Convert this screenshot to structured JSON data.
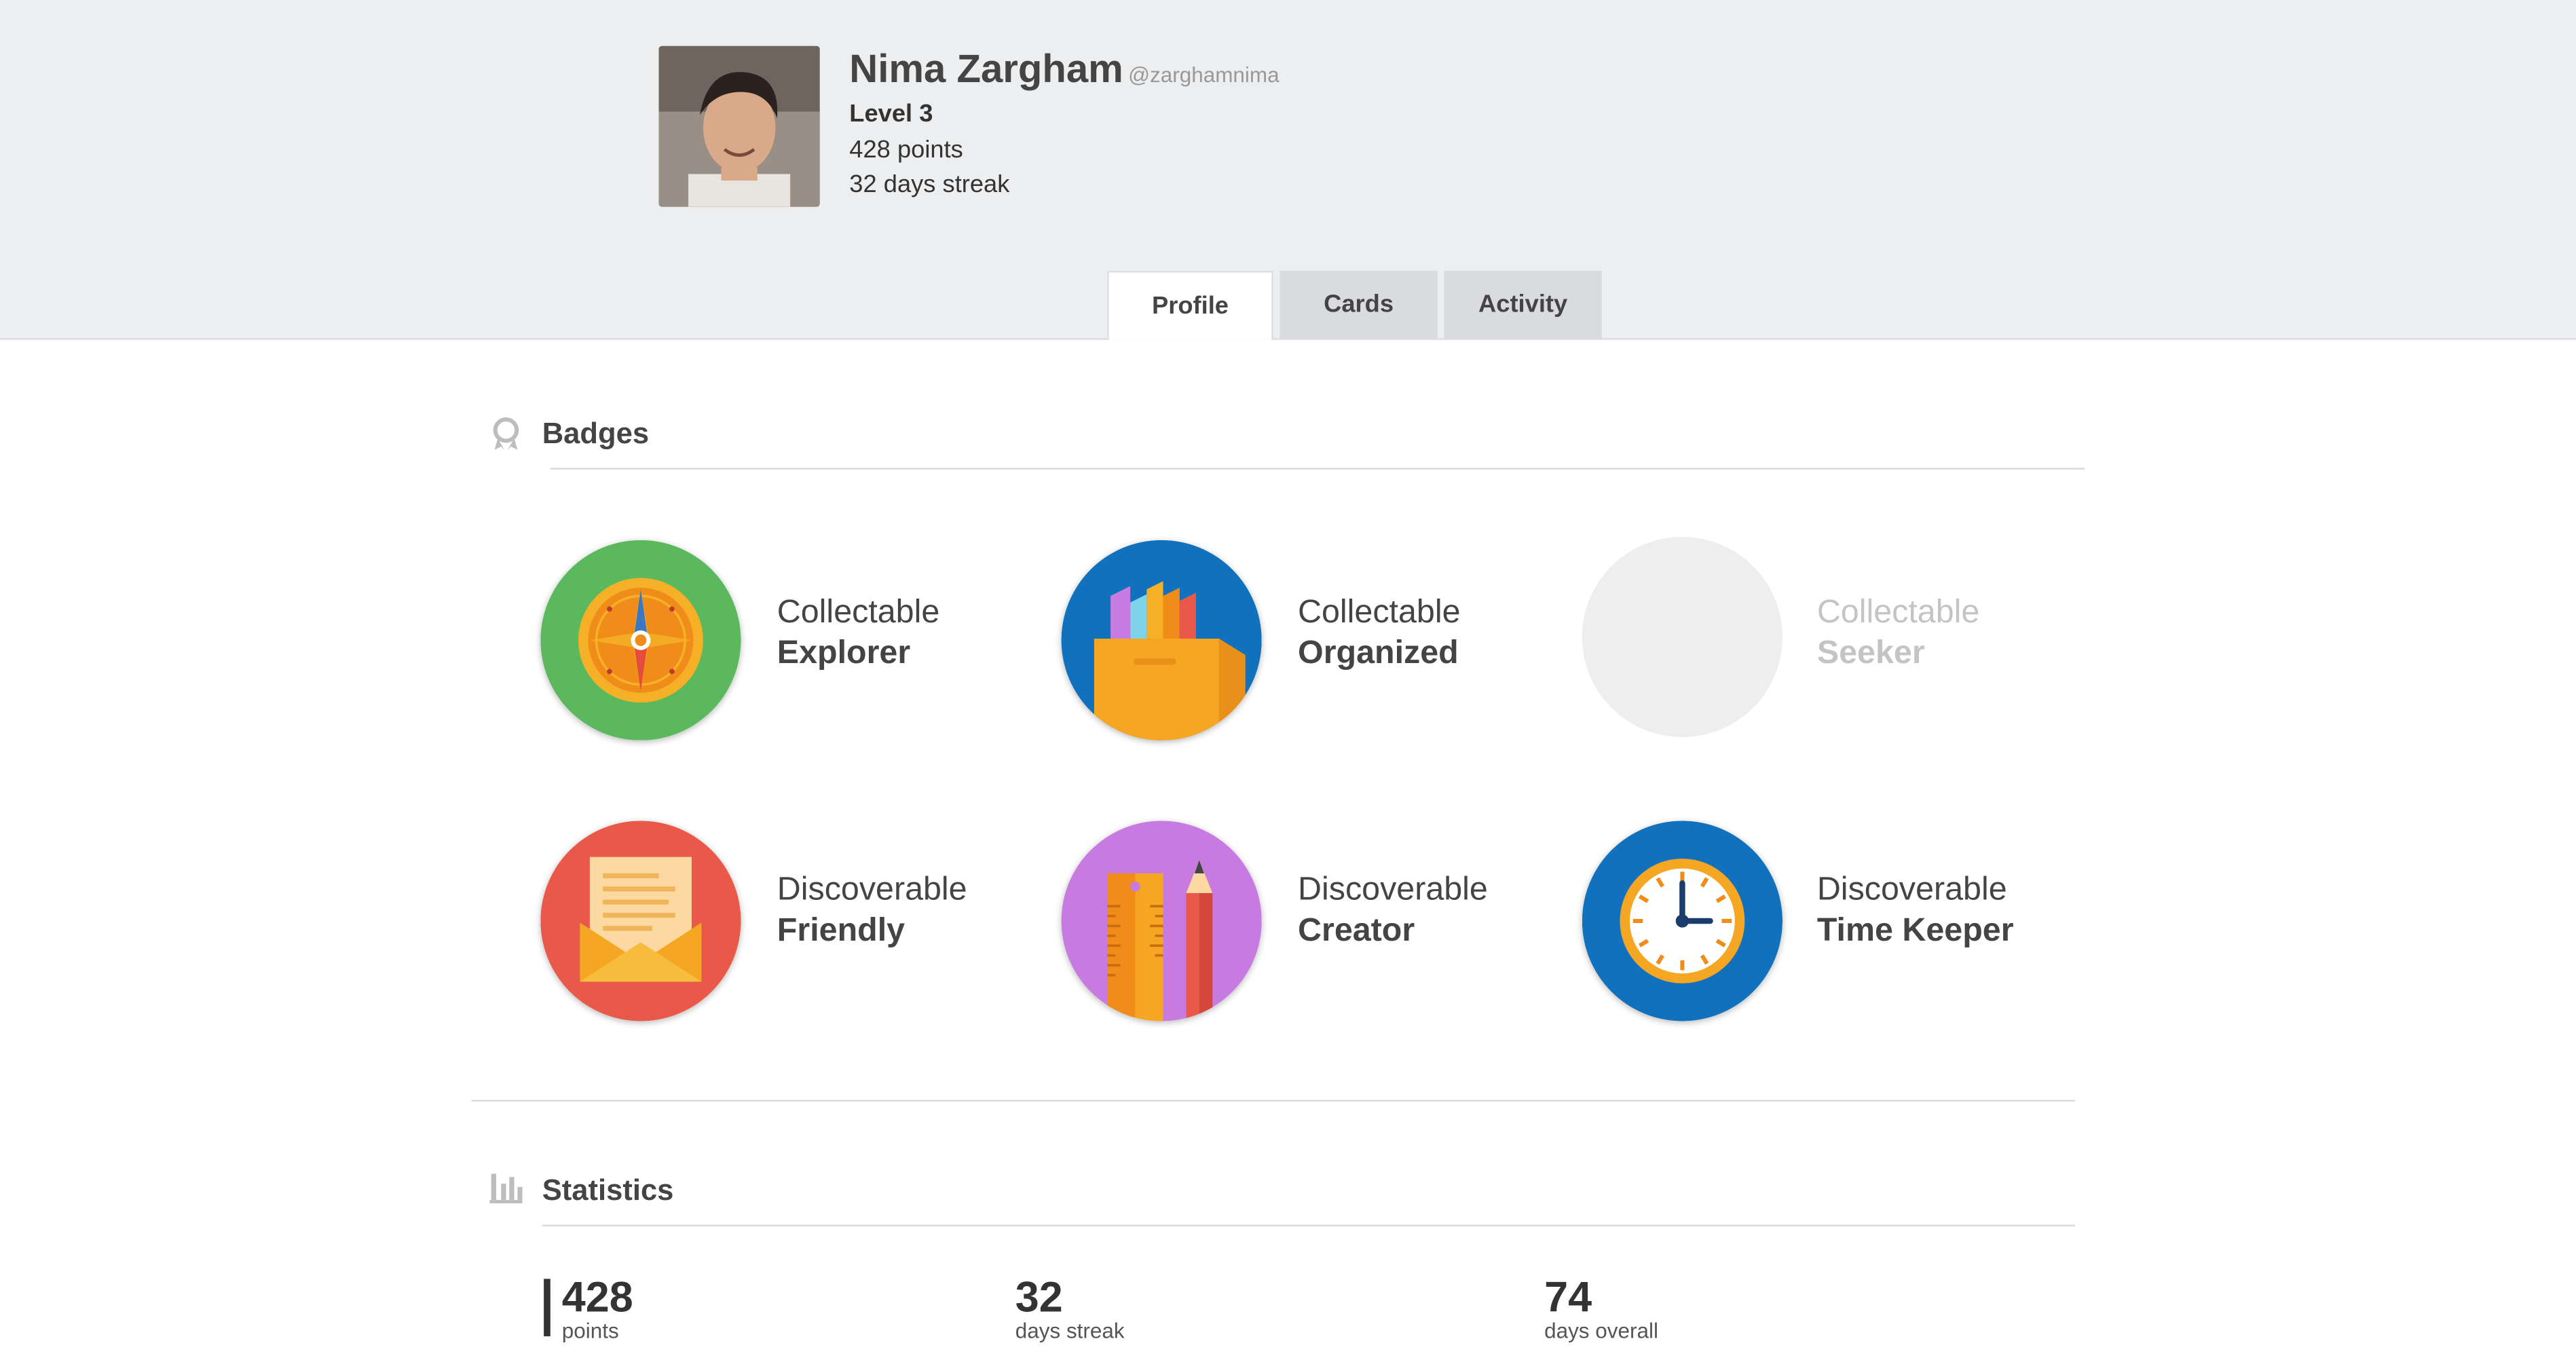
{
  "profile": {
    "name": "Nima Zargham",
    "handle": "@zarghamnima",
    "level": "Level 3",
    "points": "428 points",
    "streak": "32 days streak"
  },
  "tabs": [
    {
      "label": "Profile",
      "active": true
    },
    {
      "label": "Cards",
      "active": false
    },
    {
      "label": "Activity",
      "active": false
    }
  ],
  "badges_section": {
    "title": "Badges",
    "icon": "badge-ribbon-icon",
    "items": [
      {
        "kind": "Collectable",
        "name": "Explorer",
        "icon": "compass-icon",
        "color": "#5cb85c",
        "earned": true
      },
      {
        "kind": "Collectable",
        "name": "Organized",
        "icon": "folder-files-icon",
        "color": "#1271bd",
        "earned": true
      },
      {
        "kind": "Collectable",
        "name": "Seeker",
        "icon": "",
        "color": "#eeeeee",
        "earned": false
      },
      {
        "kind": "Discoverable",
        "name": "Friendly",
        "icon": "envelope-letter-icon",
        "color": "#e9594a",
        "earned": true
      },
      {
        "kind": "Discoverable",
        "name": "Creator",
        "icon": "ruler-pencil-icon",
        "color": "#c77be0",
        "earned": true
      },
      {
        "kind": "Discoverable",
        "name": "Time Keeper",
        "icon": "clock-icon",
        "color": "#1271bd",
        "earned": true
      }
    ]
  },
  "statistics_section": {
    "title": "Statistics",
    "icon": "bar-chart-icon",
    "items": [
      {
        "value": "428",
        "label": "points"
      },
      {
        "value": "32",
        "label": "days streak"
      },
      {
        "value": "74",
        "label": "days overall"
      }
    ]
  }
}
